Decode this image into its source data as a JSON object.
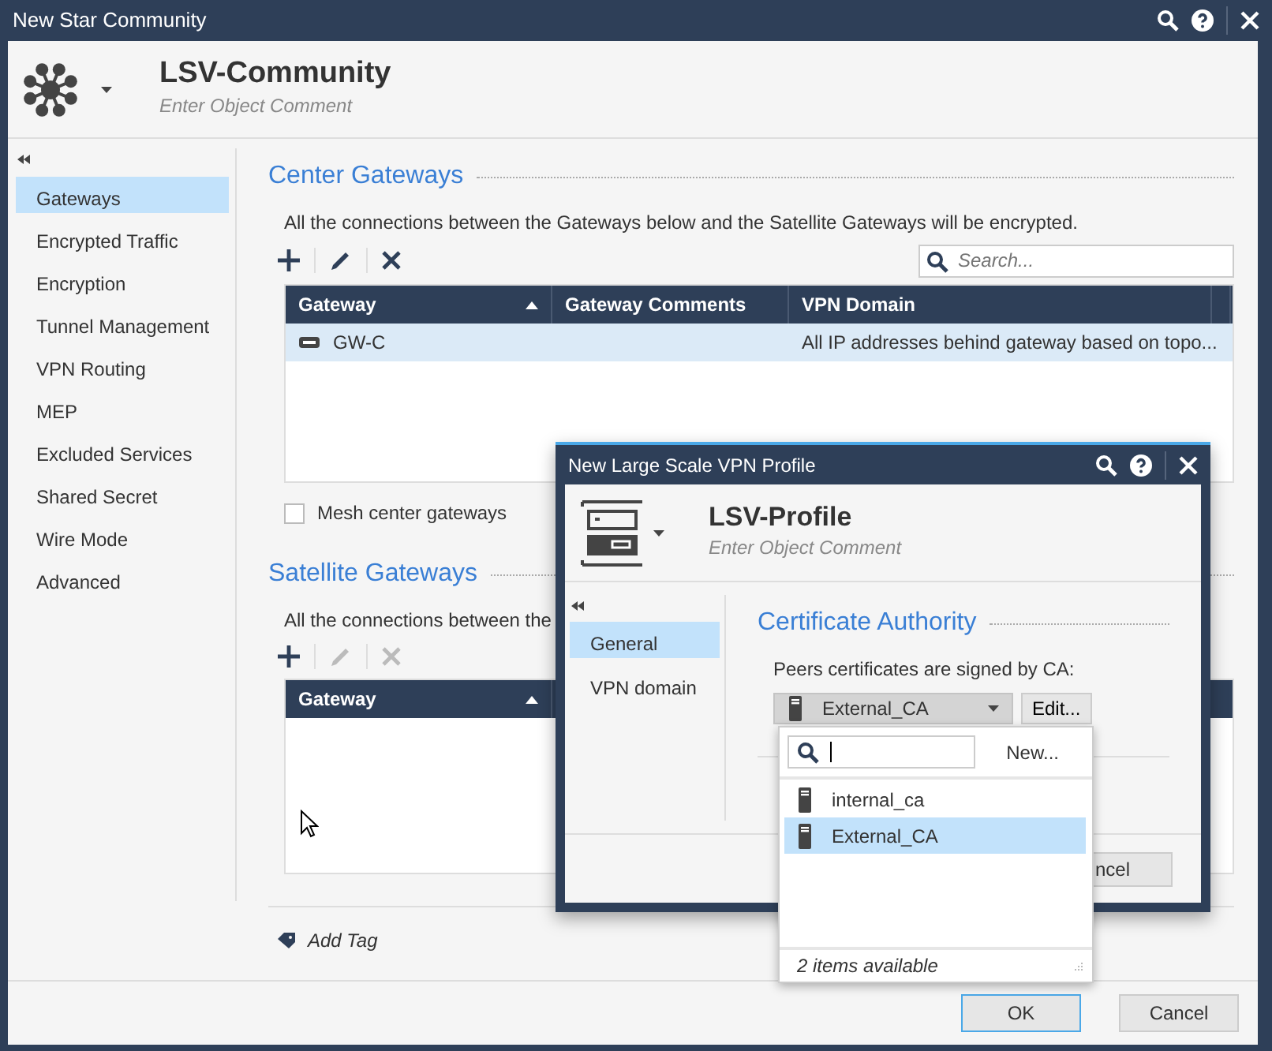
{
  "window": {
    "title": "New Star Community"
  },
  "header": {
    "name": "LSV-Community",
    "comment": "Enter Object Comment"
  },
  "sidebar": {
    "items": [
      {
        "label": "Gateways",
        "selected": true
      },
      {
        "label": "Encrypted Traffic",
        "selected": false
      },
      {
        "label": "Encryption",
        "selected": false
      },
      {
        "label": "Tunnel Management",
        "selected": false
      },
      {
        "label": "VPN Routing",
        "selected": false
      },
      {
        "label": "MEP",
        "selected": false
      },
      {
        "label": "Excluded Services",
        "selected": false
      },
      {
        "label": "Shared Secret",
        "selected": false
      },
      {
        "label": "Wire Mode",
        "selected": false
      },
      {
        "label": "Advanced",
        "selected": false
      }
    ]
  },
  "center_gateways": {
    "title": "Center Gateways",
    "description": "All the connections between the Gateways below and the Satellite Gateways will be encrypted.",
    "toolbar": [
      {
        "kind": "add",
        "disabled": false
      },
      {
        "kind": "edit",
        "disabled": false
      },
      {
        "kind": "delete",
        "disabled": false
      }
    ],
    "search": {
      "placeholder": "Search..."
    },
    "table": {
      "columns": [
        "Gateway",
        "Gateway Comments",
        "VPN Domain"
      ],
      "rows": [
        {
          "gateway": "GW-C",
          "vpn_domain": "All IP addresses behind gateway based on topo...",
          "selected": true
        }
      ]
    }
  },
  "mesh": {
    "label": "Mesh center gateways",
    "checked": false
  },
  "satellite_gateways": {
    "title": "Satellite Gateways",
    "description": "All the connections between the",
    "toolbar": [
      {
        "kind": "add",
        "disabled": false
      },
      {
        "kind": "edit",
        "disabled": true
      },
      {
        "kind": "delete",
        "disabled": true
      }
    ],
    "table": {
      "columns": [
        "Gateway"
      ]
    }
  },
  "add_tag": "Add Tag",
  "buttons": [
    {
      "label": "OK",
      "kind": "primary"
    },
    {
      "label": "Cancel",
      "kind": "secondary"
    }
  ],
  "dialog": {
    "title": "New Large Scale VPN Profile",
    "name": "LSV-Profile",
    "comment": "Enter Object Comment",
    "sidebar": {
      "items": [
        {
          "label": "General",
          "selected": true
        },
        {
          "label": "VPN domain",
          "selected": false
        }
      ]
    },
    "section_title": "Certificate Authority",
    "ca_label": "Peers certificates are signed by CA:",
    "ca_value": "External_CA",
    "edit_button": "Edit...",
    "cancel_button": "ncel"
  },
  "dropdown": {
    "new_link": "New...",
    "items": [
      {
        "label": "internal_ca",
        "selected": false
      },
      {
        "label": "External_CA",
        "selected": true
      }
    ],
    "footer": "2 items available"
  }
}
